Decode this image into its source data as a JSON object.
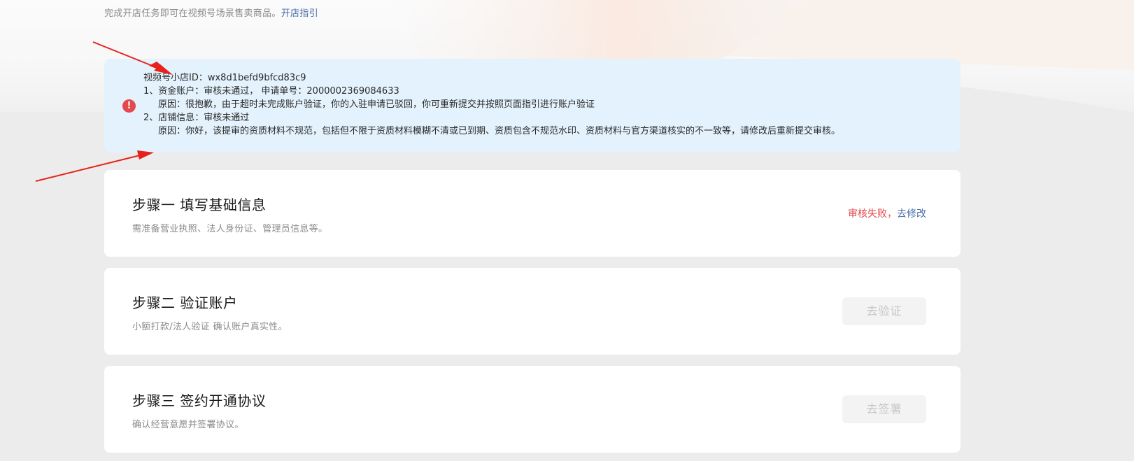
{
  "header": {
    "tip_text": "完成开店任务即可在视频号场景售卖商品。",
    "guide_link": "开店指引"
  },
  "alert": {
    "icon": "exclamation-icon",
    "shop_id_line": "视频号小店ID：wx8d1befd9bfcd83c9",
    "item1_line": "1、资金账户：审核未通过，  申请单号：2000002369084633",
    "item1_reason": "原因：很抱歉，由于超时未完成账户验证，你的入驻申请已驳回，你可重新提交并按照页面指引进行账户验证",
    "item2_line": "2、店铺信息：审核未通过",
    "item2_reason": "原因：你好，该提审的资质材料不规范，包括但不限于资质材料模糊不清或已到期、资质包含不规范水印、资质材料与官方渠道核实的不一致等，请修改后重新提交审核。"
  },
  "steps": [
    {
      "title": "步骤一 填写基础信息",
      "desc": "需准备营业执照、法人身份证、管理员信息等。",
      "status_fail": "审核失败，",
      "status_action": "去修改"
    },
    {
      "title": "步骤二 验证账户",
      "desc": "小额打款/法人验证 确认账户真实性。",
      "button": "去验证"
    },
    {
      "title": "步骤三 签约开通协议",
      "desc": "确认经营意愿并签署协议。",
      "button": "去签署"
    }
  ],
  "colors": {
    "alert_bg": "#e3f2fc",
    "error_red": "#e5484d",
    "link_blue": "#4a6ea9",
    "annotation_arrow": "#e8221b"
  }
}
